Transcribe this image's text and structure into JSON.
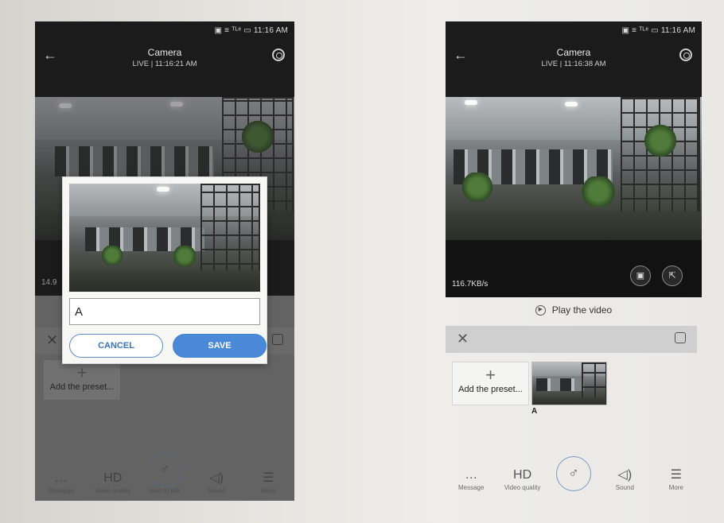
{
  "left": {
    "status": "▣ ≡ ᵀᴸᵉ ▭ 11:16 AM",
    "title": "Camera",
    "subtitle": "LIVE | 11:16:21 AM",
    "speed": "14.9",
    "preset_add_label": "Add the preset...",
    "dialog": {
      "input_value": "A",
      "cancel_label": "CANCEL",
      "save_label": "SAVE"
    },
    "bottom": [
      {
        "icon": "…",
        "label": "Message"
      },
      {
        "icon": "HD",
        "label": "Video quality"
      },
      {
        "icon": "♂",
        "label": "Hold to talk"
      },
      {
        "icon": "◁)",
        "label": "Sound"
      },
      {
        "icon": "☰",
        "label": "More"
      }
    ]
  },
  "right": {
    "status": "▣ ≡ ᵀᴸᵉ ▭ 11:16 AM",
    "title": "Camera",
    "subtitle": "LIVE | 11:16:38 AM",
    "speed": "116.7KB/s",
    "play_label": "Play the video",
    "preset_add_label": "Add the preset...",
    "preset_name": "A",
    "bottom": [
      {
        "icon": "…",
        "label": "Message"
      },
      {
        "icon": "HD",
        "label": "Video quality"
      },
      {
        "icon": "♂",
        "label": ""
      },
      {
        "icon": "◁)",
        "label": "Sound"
      },
      {
        "icon": "☰",
        "label": "More"
      }
    ]
  }
}
